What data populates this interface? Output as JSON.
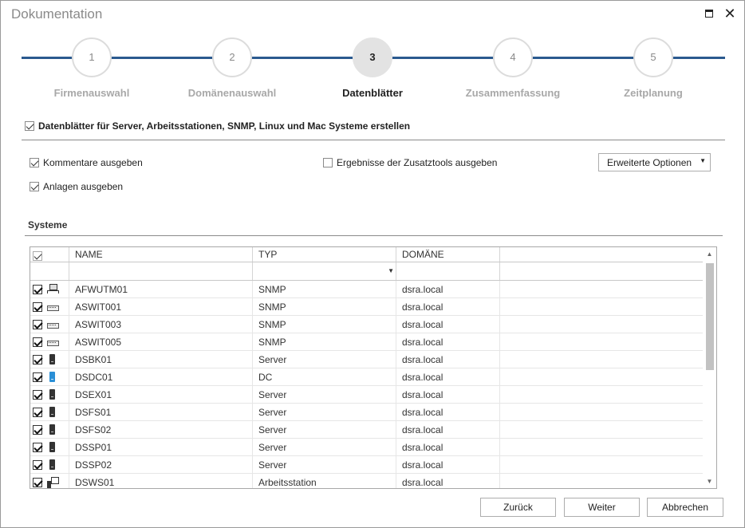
{
  "window": {
    "title": "Dokumentation",
    "maximize_glyph": "",
    "close_glyph": "✕"
  },
  "steps": [
    {
      "number": "1",
      "label": "Firmenauswahl",
      "active": false
    },
    {
      "number": "2",
      "label": "Domänenauswahl",
      "active": false
    },
    {
      "number": "3",
      "label": "Datenblätter",
      "active": true
    },
    {
      "number": "4",
      "label": "Zusammenfassung",
      "active": false
    },
    {
      "number": "5",
      "label": "Zeitplanung",
      "active": false
    }
  ],
  "main_option": {
    "label": "Datenblätter für Server, Arbeitsstationen, SNMP, Linux und Mac Systeme erstellen",
    "checked": true
  },
  "options": {
    "comments": {
      "label": "Kommentare ausgeben",
      "checked": true
    },
    "attachments": {
      "label": "Anlagen ausgeben",
      "checked": true
    },
    "tools": {
      "label": "Ergebnisse der Zusatztools ausgeben",
      "checked": false
    },
    "advanced_button": "Erweiterte Optionen",
    "advanced_arrow": "▼"
  },
  "systems": {
    "title": "Systeme",
    "columns": [
      "NAME",
      "TYP",
      "DOMÄNE"
    ],
    "filter_arrow": "▼",
    "scroll_up": "▲",
    "scroll_down": "▼",
    "rows": [
      {
        "name": "AFWUTM01",
        "type": "SNMP",
        "domain": "dsra.local",
        "icon": "network-icon",
        "checked": true
      },
      {
        "name": "ASWIT001",
        "type": "SNMP",
        "domain": "dsra.local",
        "icon": "switch-icon",
        "checked": true
      },
      {
        "name": "ASWIT003",
        "type": "SNMP",
        "domain": "dsra.local",
        "icon": "switch-icon",
        "checked": true
      },
      {
        "name": "ASWIT005",
        "type": "SNMP",
        "domain": "dsra.local",
        "icon": "switch-icon",
        "checked": true
      },
      {
        "name": "DSBK01",
        "type": "Server",
        "domain": "dsra.local",
        "icon": "server-icon",
        "checked": true
      },
      {
        "name": "DSDC01",
        "type": "DC",
        "domain": "dsra.local",
        "icon": "domain-controller-icon",
        "checked": true
      },
      {
        "name": "DSEX01",
        "type": "Server",
        "domain": "dsra.local",
        "icon": "server-icon",
        "checked": true
      },
      {
        "name": "DSFS01",
        "type": "Server",
        "domain": "dsra.local",
        "icon": "server-icon",
        "checked": true
      },
      {
        "name": "DSFS02",
        "type": "Server",
        "domain": "dsra.local",
        "icon": "server-icon",
        "checked": true
      },
      {
        "name": "DSSP01",
        "type": "Server",
        "domain": "dsra.local",
        "icon": "server-icon",
        "checked": true
      },
      {
        "name": "DSSP02",
        "type": "Server",
        "domain": "dsra.local",
        "icon": "server-icon",
        "checked": true
      },
      {
        "name": "DSWS01",
        "type": "Arbeitsstation",
        "domain": "dsra.local",
        "icon": "workstation-icon",
        "checked": true
      }
    ]
  },
  "buttons": {
    "back": "Zurück",
    "next": "Weiter",
    "cancel": "Abbrechen"
  },
  "colors": {
    "accent_line": "#2b5a8f",
    "dc_icon": "#2a8fd6"
  }
}
